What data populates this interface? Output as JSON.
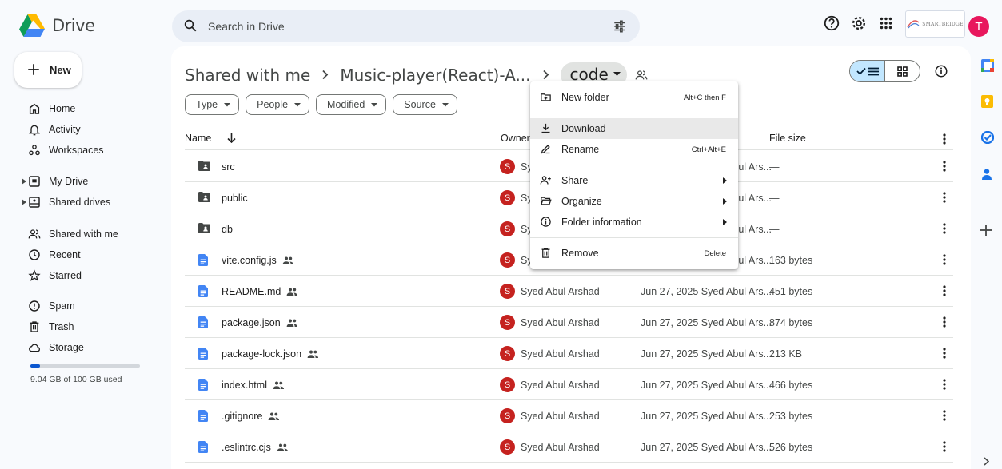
{
  "app": {
    "name": "Drive"
  },
  "search": {
    "placeholder": "Search in Drive"
  },
  "brand": {
    "label": "SMARTBRIDGE"
  },
  "user": {
    "initial": "T",
    "color": "#e8175d"
  },
  "sidebar": {
    "new_label": "New",
    "items": [
      {
        "label": "Home",
        "icon": "home-icon"
      },
      {
        "label": "Activity",
        "icon": "bell-icon"
      },
      {
        "label": "Workspaces",
        "icon": "workspaces-icon"
      },
      {
        "label": "My Drive",
        "icon": "my-drive-icon"
      },
      {
        "label": "Shared drives",
        "icon": "shared-drives-icon"
      },
      {
        "label": "Shared with me",
        "icon": "people-icon"
      },
      {
        "label": "Recent",
        "icon": "clock-icon"
      },
      {
        "label": "Starred",
        "icon": "star-icon"
      },
      {
        "label": "Spam",
        "icon": "spam-icon"
      },
      {
        "label": "Trash",
        "icon": "trash-icon"
      },
      {
        "label": "Storage",
        "icon": "cloud-icon"
      }
    ],
    "storage_text": "9.04 GB of 100 GB used",
    "storage_fraction": 0.09
  },
  "breadcrumb": {
    "items": [
      "Shared with me",
      "Music-player(React)-A...",
      "code"
    ]
  },
  "filters": [
    "Type",
    "People",
    "Modified",
    "Source"
  ],
  "table": {
    "headers": {
      "name": "Name",
      "owner": "Owner",
      "size": "File size"
    },
    "rows": [
      {
        "name": "src",
        "type": "folder",
        "shared": false,
        "owner": "Syed Abul Arshad",
        "owner_initial": "S",
        "modified": "Jun 27, 2025 Syed Abul Ars...",
        "size": "—"
      },
      {
        "name": "public",
        "type": "folder",
        "shared": false,
        "owner": "Syed Abul Arshad",
        "owner_initial": "S",
        "modified": "Jun 27, 2025 Syed Abul Ars...",
        "size": "—"
      },
      {
        "name": "db",
        "type": "folder",
        "shared": false,
        "owner": "Syed Abul Arshad",
        "owner_initial": "S",
        "modified": "Jun 27, 2025 Syed Abul Ars...",
        "size": "—"
      },
      {
        "name": "vite.config.js",
        "type": "doc",
        "shared": true,
        "owner": "Syed Abul Arshad",
        "owner_initial": "S",
        "modified": "Jun 27, 2025 Syed Abul Ars...",
        "size": "163 bytes"
      },
      {
        "name": "README.md",
        "type": "doc",
        "shared": true,
        "owner": "Syed Abul Arshad",
        "owner_initial": "S",
        "modified": "Jun 27, 2025 Syed Abul Ars...",
        "size": "451 bytes"
      },
      {
        "name": "package.json",
        "type": "doc",
        "shared": true,
        "owner": "Syed Abul Arshad",
        "owner_initial": "S",
        "modified": "Jun 27, 2025 Syed Abul Ars...",
        "size": "874 bytes"
      },
      {
        "name": "package-lock.json",
        "type": "doc",
        "shared": true,
        "owner": "Syed Abul Arshad",
        "owner_initial": "S",
        "modified": "Jun 27, 2025 Syed Abul Ars...",
        "size": "213 KB"
      },
      {
        "name": "index.html",
        "type": "doc",
        "shared": true,
        "owner": "Syed Abul Arshad",
        "owner_initial": "S",
        "modified": "Jun 27, 2025 Syed Abul Ars...",
        "size": "466 bytes"
      },
      {
        "name": ".gitignore",
        "type": "doc",
        "shared": true,
        "owner": "Syed Abul Arshad",
        "owner_initial": "S",
        "modified": "Jun 27, 2025 Syed Abul Ars...",
        "size": "253 bytes"
      },
      {
        "name": ".eslintrc.cjs",
        "type": "doc",
        "shared": true,
        "owner": "Syed Abul Arshad",
        "owner_initial": "S",
        "modified": "Jun 27, 2025 Syed Abul Ars...",
        "size": "526 bytes"
      }
    ]
  },
  "context_menu": {
    "new_folder": {
      "label": "New folder",
      "shortcut": "Alt+C then F"
    },
    "download": {
      "label": "Download"
    },
    "rename": {
      "label": "Rename",
      "shortcut": "Ctrl+Alt+E"
    },
    "share": {
      "label": "Share"
    },
    "organize": {
      "label": "Organize"
    },
    "folder_info": {
      "label": "Folder information"
    },
    "remove": {
      "label": "Remove",
      "shortcut": "Delete"
    }
  },
  "colors": {
    "accent": "#0b57d0",
    "owner_avatar": "#c5221f",
    "view_selected": "#c2e7ff",
    "doc_icon": "#4285f4"
  }
}
